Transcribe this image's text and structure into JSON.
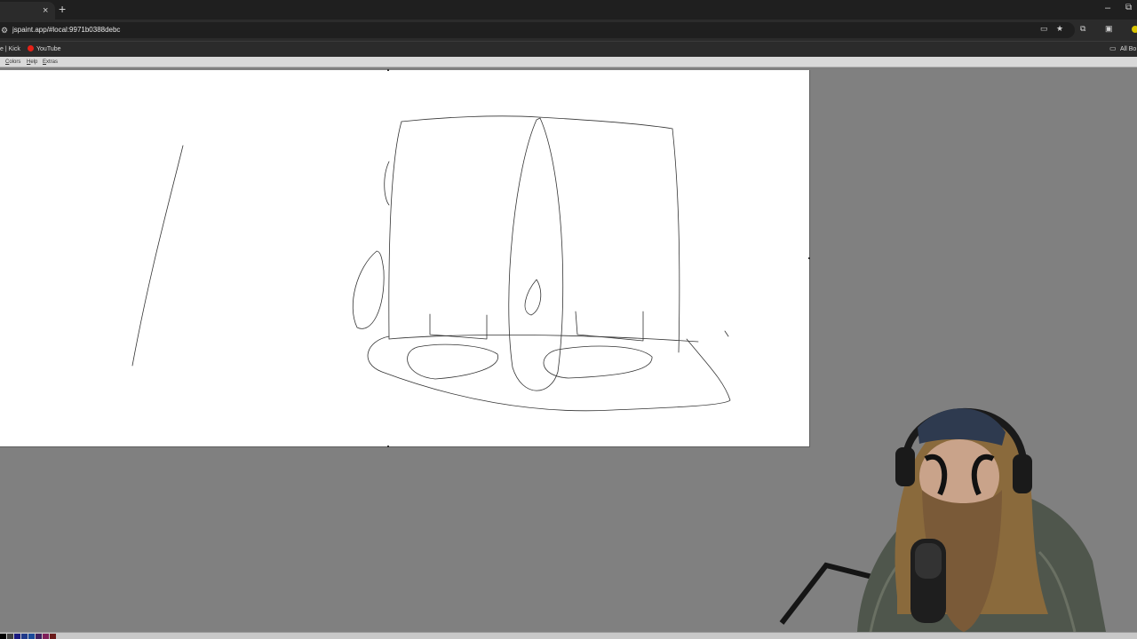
{
  "browser": {
    "tab_close": "×",
    "new_tab": "+",
    "minimize": "–",
    "restore": "⧉",
    "url": "jspaint.app/#local:9971b0388debc",
    "bookmarks": [
      {
        "label": "e | Kick"
      },
      {
        "label": "YouTube"
      }
    ],
    "all_bookmarks": "All Bo"
  },
  "app": {
    "menus": [
      {
        "label": "Colors"
      },
      {
        "label": "Help"
      },
      {
        "label": "Extras"
      }
    ]
  },
  "palette": [
    "#000000",
    "#404040",
    "#1a1a80",
    "#203a8a",
    "#1a4a9a",
    "#402060",
    "#80205a",
    "#6a1a1a"
  ],
  "icons": {
    "site_info": "site-settings-icon",
    "install": "install-app-icon",
    "star": "bookmark-star-icon",
    "extensions": "extensions-icon",
    "media": "media-router-icon",
    "folder": "folder-icon"
  }
}
